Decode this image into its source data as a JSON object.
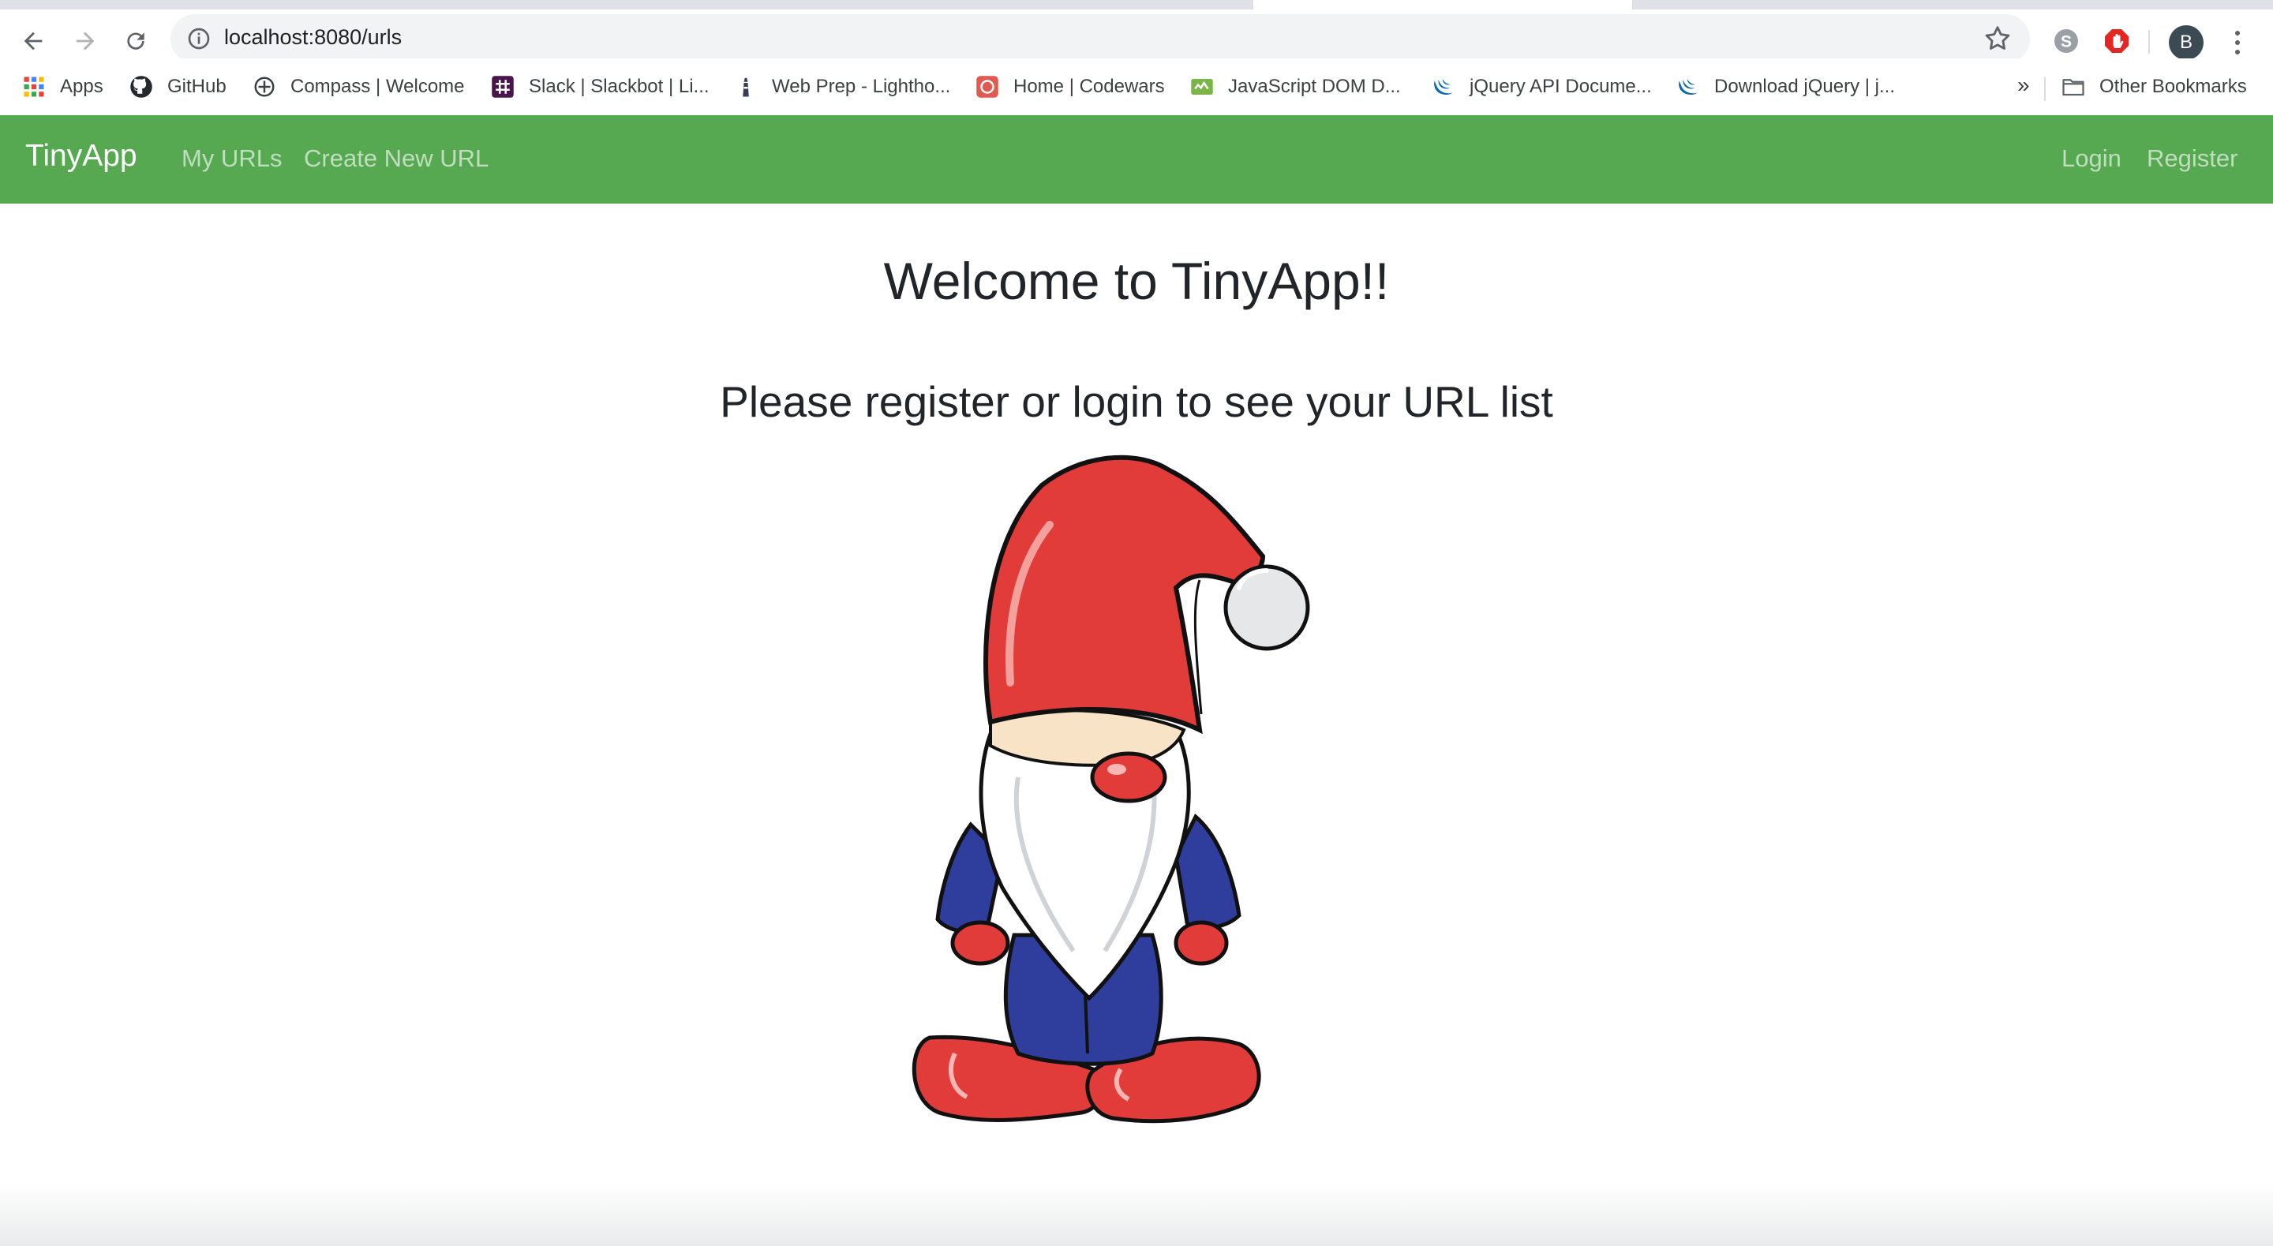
{
  "browser": {
    "url": "localhost:8080/urls",
    "profile_initial": "B",
    "bookmarks": [
      {
        "label": "Apps",
        "icon": "apps-grid-icon"
      },
      {
        "label": "GitHub",
        "icon": "github-icon"
      },
      {
        "label": "Compass | Welcome",
        "icon": "compass-icon"
      },
      {
        "label": "Slack | Slackbot | Li...",
        "icon": "slack-icon"
      },
      {
        "label": "Web Prep - Lightho...",
        "icon": "lighthouse-icon"
      },
      {
        "label": "Home | Codewars",
        "icon": "codewars-icon"
      },
      {
        "label": "JavaScript DOM D...",
        "icon": "javascript-dom-icon"
      },
      {
        "label": "jQuery API Docume...",
        "icon": "jquery-icon"
      },
      {
        "label": "Download jQuery | j...",
        "icon": "jquery-icon"
      }
    ],
    "bookmarks_overflow": "»",
    "other_bookmarks": "Other Bookmarks"
  },
  "navbar": {
    "brand": "TinyApp",
    "links": [
      "My URLs",
      "Create New URL"
    ],
    "login": "Login",
    "register": "Register",
    "color": "#56a851"
  },
  "main": {
    "heading": "Welcome to TinyApp!!",
    "subheading": "Please register or login to see your URL list",
    "image": "gnome-illustration"
  }
}
